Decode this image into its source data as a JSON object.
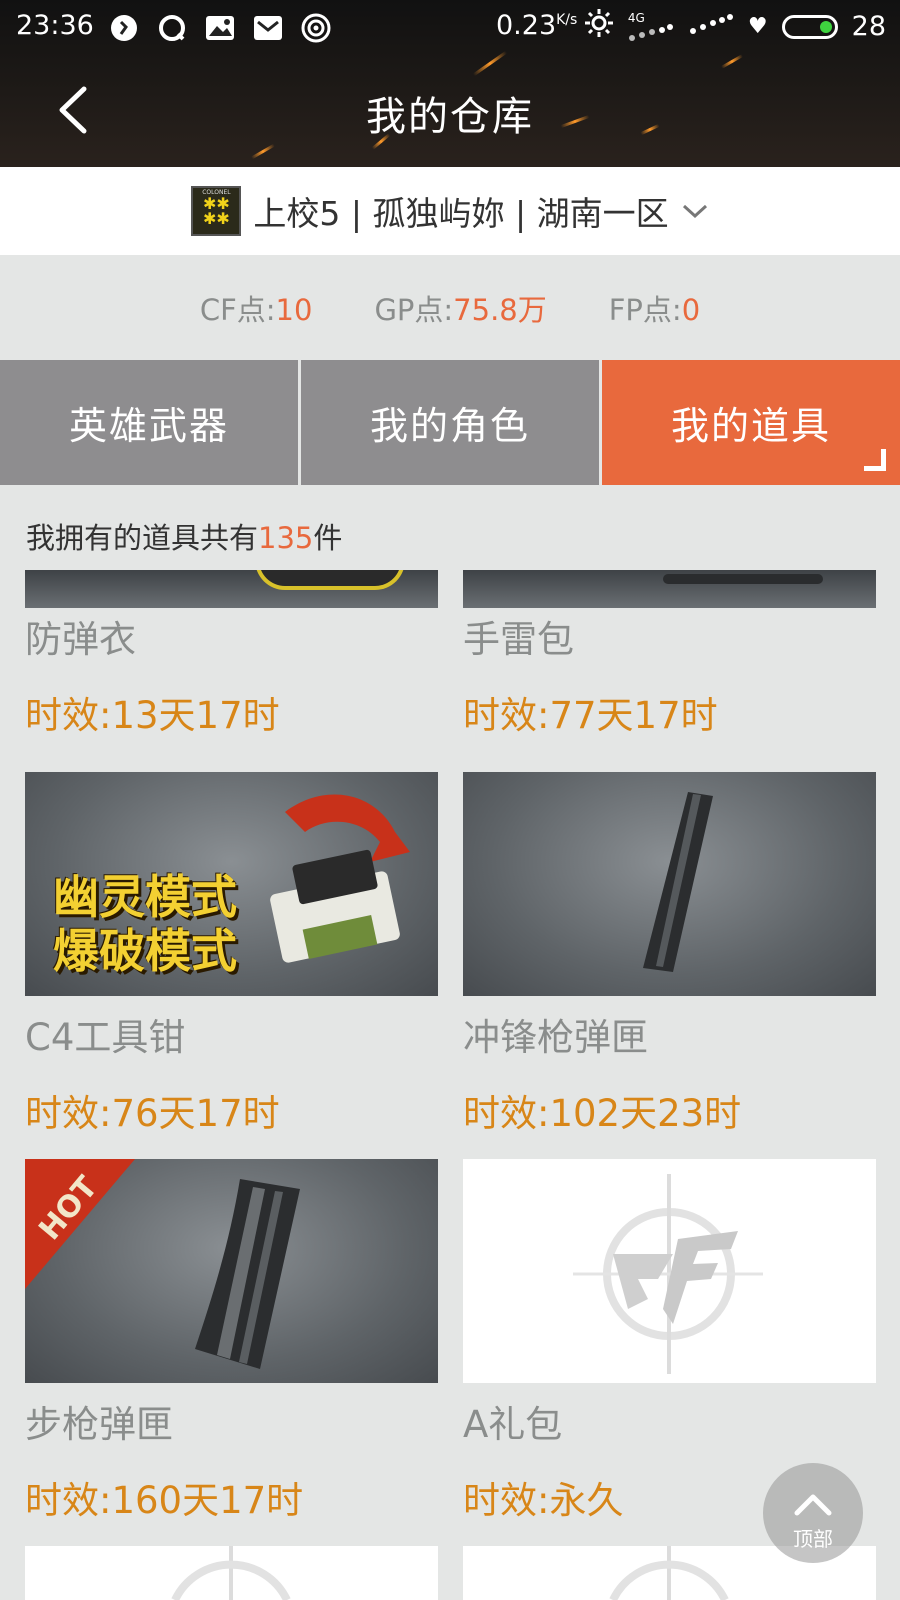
{
  "status_bar": {
    "time": "23:36",
    "net_speed": "0.23",
    "net_unit": "K/s",
    "network": "4G",
    "battery": "28"
  },
  "nav": {
    "title": "我的仓库",
    "back_icon": "chevron-left-icon"
  },
  "account": {
    "rank_badge_text": "COLONEL",
    "text": "上校5 | 孤独屿妳 | 湖南一区"
  },
  "currency": [
    {
      "label": "CF点:",
      "value": "10"
    },
    {
      "label": "GP点:",
      "value": "75.8万"
    },
    {
      "label": "FP点:",
      "value": "0"
    }
  ],
  "tabs": [
    {
      "label": "英雄武器",
      "active": false
    },
    {
      "label": "我的角色",
      "active": false
    },
    {
      "label": "我的道具",
      "active": true
    }
  ],
  "inventory": {
    "count_prefix": "我拥有的道具共有",
    "count": "135",
    "count_suffix": "件",
    "items": [
      {
        "name": "防弹衣",
        "time": "时效:13天17时"
      },
      {
        "name": "手雷包",
        "time": "时效:77天17时"
      },
      {
        "name": "C4工具钳",
        "time": "时效:76天17时",
        "image_text": [
          "幽灵模式",
          "爆破模式"
        ]
      },
      {
        "name": "冲锋枪弹匣",
        "time": "时效:102天23时"
      },
      {
        "name": "步枪弹匣",
        "time": "时效:160天17时",
        "badge": "HOT"
      },
      {
        "name": "A礼包",
        "time": "时效:永久"
      }
    ]
  },
  "float_button": {
    "label": "顶部"
  },
  "colors": {
    "accent": "#e8693d",
    "time_text": "#d88618",
    "tab_inactive": "#8e8d8f"
  }
}
